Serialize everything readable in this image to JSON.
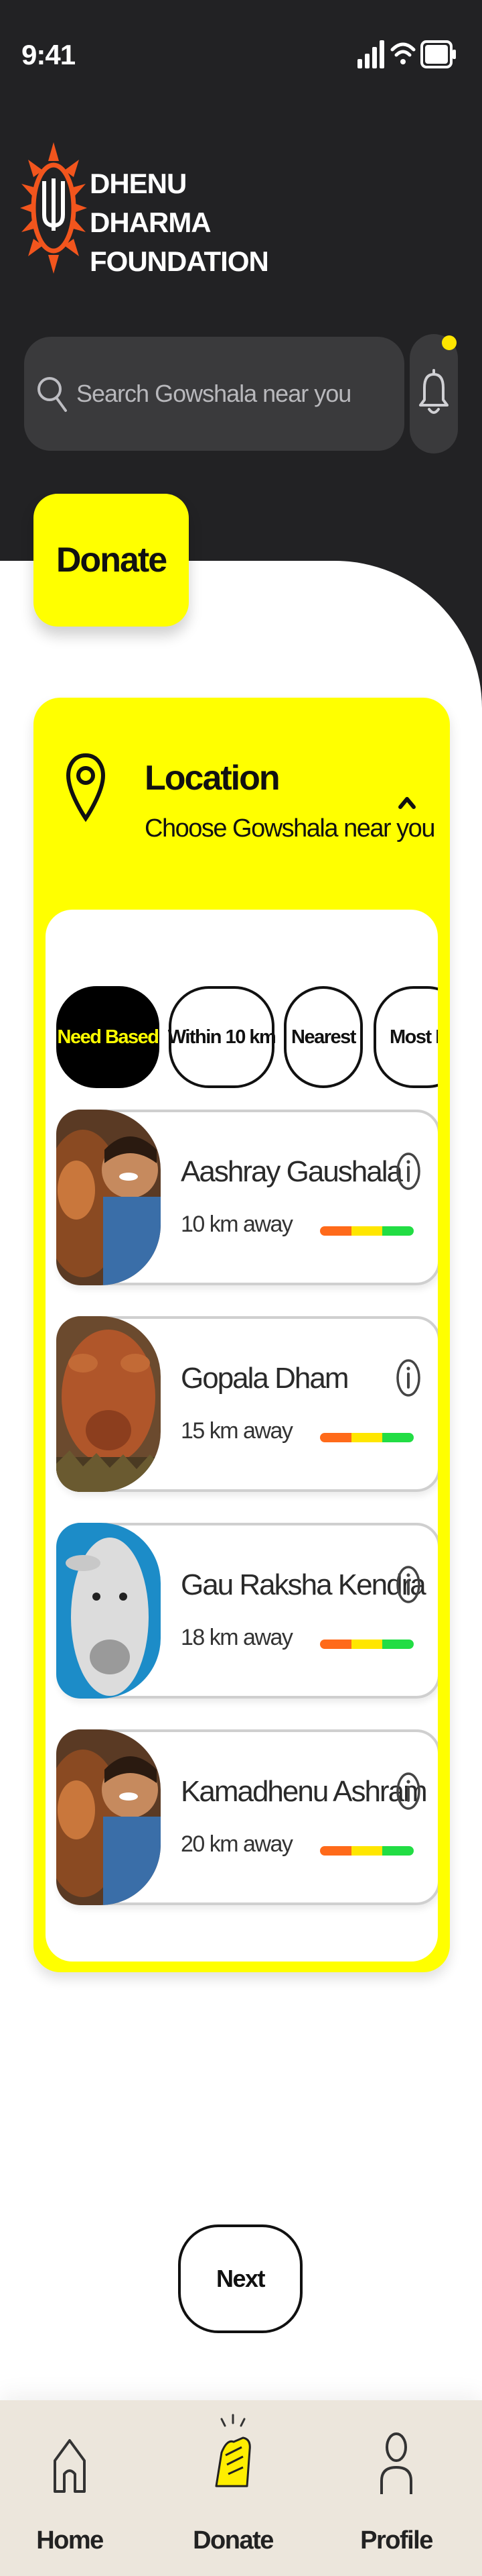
{
  "status_bar": {
    "time": "9:41"
  },
  "brand": {
    "line1": "DHENU DHARMA",
    "line2": "FOUNDATION"
  },
  "search": {
    "placeholder": "Search Gowshala near you"
  },
  "page_title": "Donate",
  "location": {
    "title": "Location",
    "subtitle": "Choose Gowshala near you"
  },
  "filters": [
    {
      "label": "Need Based",
      "active": true
    },
    {
      "label": "Within 10 km",
      "active": false
    },
    {
      "label": "Nearest",
      "active": false
    },
    {
      "label": "Most Rev",
      "active": false
    }
  ],
  "gowshalas": [
    {
      "name": "Aashray Gaushala",
      "distance": "10 km away",
      "image": "man-with-calf"
    },
    {
      "name": "Gopala Dham",
      "distance": "15 km away",
      "image": "brown-calf"
    },
    {
      "name": "Gau Raksha Kendra",
      "distance": "18 km away",
      "image": "white-bull"
    },
    {
      "name": "Kamadhenu Ashram",
      "distance": "20 km away",
      "image": "man-with-calf"
    }
  ],
  "rating_bar_colors": [
    "#ff6a1a",
    "#ffe600",
    "#22dd44"
  ],
  "next_label": "Next",
  "tabs": [
    {
      "label": "Home",
      "icon": "home-icon"
    },
    {
      "label": "Donate",
      "icon": "handshake-icon"
    },
    {
      "label": "Profile",
      "icon": "user-icon"
    }
  ],
  "colors": {
    "accent": "#ffff00",
    "dark": "#222224"
  }
}
